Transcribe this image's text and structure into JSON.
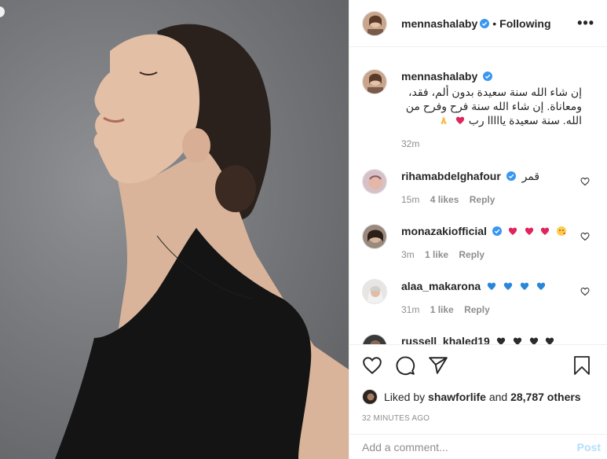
{
  "post": {
    "author": "mennashalaby",
    "follow_status": "Following",
    "more_label": "•••",
    "separator": "•"
  },
  "caption": {
    "user": "mennashalaby",
    "text": "إن شاء الله سنة سعيدة بدون ألم، فقد، ومعاناة. إن شاء الله سنة فرح وفرح من الله. سنة سعيدة يااااا رب",
    "time": "32m"
  },
  "comments": [
    {
      "user": "rihamabdelghafour",
      "verified": true,
      "text": "قمر",
      "time": "15m",
      "likes": "4 likes",
      "reply": "Reply"
    },
    {
      "user": "monazakiofficial",
      "verified": true,
      "text": "",
      "time": "3m",
      "likes": "1 like",
      "reply": "Reply"
    },
    {
      "user": "alaa_makarona",
      "verified": false,
      "text": "",
      "time": "31m",
      "likes": "1 like",
      "reply": "Reply"
    },
    {
      "user": "russell_khaled19",
      "verified": false,
      "text": "",
      "time": "",
      "likes": "",
      "reply": ""
    }
  ],
  "likes": {
    "prefix": "Liked by",
    "user": "shawforlife",
    "joiner": "and",
    "others": "28,787 others"
  },
  "timestamp": "32 MINUTES AGO",
  "add_comment": {
    "placeholder": "Add a comment...",
    "post_label": "Post"
  },
  "colors": {
    "verified": "#3897f0",
    "link": "#b2dffc",
    "meta": "#8e8e8e"
  },
  "icons": [
    "heart-icon",
    "comment-icon",
    "share-icon",
    "save-icon",
    "verified-icon",
    "more-icon"
  ]
}
